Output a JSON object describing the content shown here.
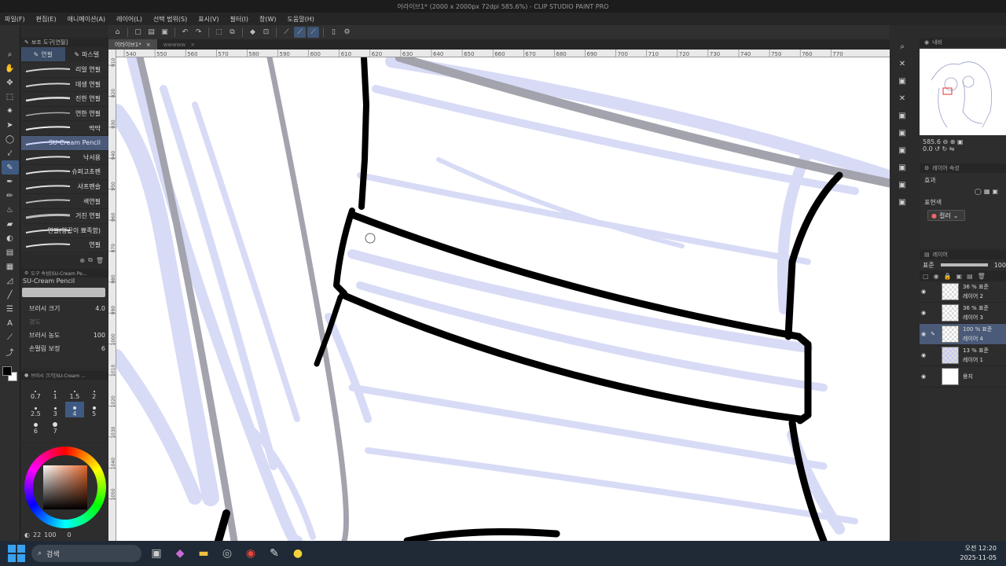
{
  "window": {
    "title": "어라이브1* (2000 x 2000px 72dpi 585.6%) - CLIP STUDIO PAINT PRO"
  },
  "menu": [
    "파일(F)",
    "편집(E)",
    "애니메이션(A)",
    "레이어(L)",
    "선택 범위(S)",
    "표시(V)",
    "필터(I)",
    "창(W)",
    "도움말(H)"
  ],
  "subtool": {
    "panel_title": "보조 도구[연필]",
    "tabs": [
      "연필",
      "파스텔"
    ],
    "brushes": [
      "리얼 연필",
      "데생 연필",
      "진한 연필",
      "연한 연필",
      "딱딱",
      "SU-Cream Pencil",
      "낙서용",
      "슈퍼고초펜",
      "샤프펜슬",
      "색연필",
      "거친 연필",
      "연필(양끝이 뾰족함)",
      "연필"
    ],
    "active_index": 5
  },
  "tool_property": {
    "title": "도구 속성[SU-Cream Pe...",
    "brush_name": "SU-Cream Pencil",
    "rows": [
      {
        "label": "브러시 크기",
        "value": "4.0"
      },
      {
        "label": "경도",
        "value": ""
      },
      {
        "label": "브러시 농도",
        "value": "100"
      },
      {
        "label": "손떨림 보정",
        "value": "6"
      }
    ]
  },
  "brush_size": {
    "title": "브러시 크기[SU-Cream ...",
    "sizes": [
      "0.7",
      "1",
      "1.5",
      "2",
      "2.5",
      "3",
      "4",
      "5",
      "6",
      "7"
    ],
    "active": "4"
  },
  "color": {
    "fg": "#000000",
    "bg": "#ffffff",
    "footer_val1": "22",
    "footer_val2": "100",
    "footer_val3": "0"
  },
  "doc_tabs": [
    "어라이브1*",
    "wwwww"
  ],
  "ruler": {
    "top_labels": [
      "540",
      "550",
      "560",
      "570",
      "580",
      "590",
      "600",
      "610",
      "620",
      "630",
      "640",
      "650",
      "660",
      "670",
      "680",
      "690",
      "700",
      "710",
      "720",
      "730",
      "740",
      "750",
      "760",
      "770"
    ],
    "left_labels": [
      "910",
      "920",
      "930",
      "940",
      "950",
      "960",
      "970",
      "980",
      "990",
      "1000",
      "1010",
      "1020",
      "1030",
      "1040",
      "1050"
    ]
  },
  "navigator": {
    "title": "내비",
    "zoom": "585.6",
    "angle": "0.0"
  },
  "layer_property": {
    "title": "레이어 속성",
    "effect_label": "효과",
    "expr_label": "표현색",
    "expr_value": "컬러"
  },
  "layers": {
    "title": "레이어",
    "blend": "표준",
    "opacity": "100",
    "items": [
      {
        "pct": "36 % 표준",
        "name": "레이어 2",
        "thumb": "check"
      },
      {
        "pct": "36 % 표준",
        "name": "레이어 3",
        "thumb": "check"
      },
      {
        "pct": "100 % 표준",
        "name": "레이어 4",
        "thumb": "check",
        "active": true
      },
      {
        "pct": "13 % 표준",
        "name": "레이어 1",
        "thumb": "blue"
      },
      {
        "pct": "",
        "name": "용지",
        "thumb": "paper"
      }
    ]
  },
  "taskbar": {
    "search_placeholder": "검색",
    "time": "오전 12:20",
    "date": "2025-11-05"
  }
}
